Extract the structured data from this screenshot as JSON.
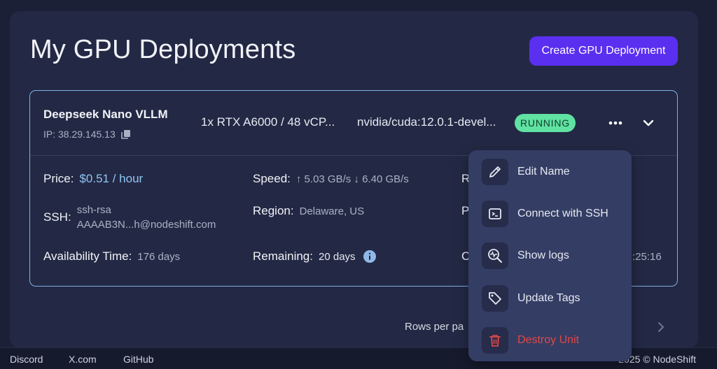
{
  "header": {
    "title": "My GPU Deployments",
    "create_label": "Create GPU Deployment"
  },
  "deployment": {
    "name": "Deepseek Nano VLLM",
    "ip": "IP: 38.29.145.13",
    "gpu": "1x RTX A6000 / 48 vCP...",
    "image": "nvidia/cuda:12.0.1-devel...",
    "status": "RUNNING",
    "price_label": "Price:",
    "price_value": "$0.51 / hour",
    "speed_label": "Speed:",
    "speed_value": "↑ 5.03 GB/s ↓ 6.40 GB/s",
    "ssh_label": "SSH:",
    "ssh_line1": "ssh-rsa",
    "ssh_line2": "AAAAB3N...h@nodeshift.com",
    "region_label": "Region:",
    "region_value": "Delaware, US",
    "availability_label": "Availability Time:",
    "availability_value": "176 days",
    "remaining_label": "Remaining:",
    "remaining_value": "20 days",
    "col3_row1_cut": "R",
    "col3_row2_cut": "P",
    "col3_row3_cut": "C",
    "col3_row3_tail": ":25:16"
  },
  "pagination": {
    "rows_label": "Rows per pa"
  },
  "menu": {
    "items": [
      {
        "label": "Edit Name",
        "icon": "pencil-icon"
      },
      {
        "label": "Connect with SSH",
        "icon": "terminal-icon"
      },
      {
        "label": "Show logs",
        "icon": "logs-search-icon"
      },
      {
        "label": "Update Tags",
        "icon": "tag-icon"
      },
      {
        "label": "Destroy Unit",
        "icon": "trash-icon"
      }
    ]
  },
  "footer": {
    "links": [
      "Discord",
      "X.com",
      "GitHub"
    ],
    "copyright": "2025 © NodeShift"
  },
  "colors": {
    "accent": "#5b2ff0",
    "running": "#5fe2a2",
    "price": "#8fc4f5",
    "danger": "#e04848",
    "card_border": "#7fb0e6"
  }
}
